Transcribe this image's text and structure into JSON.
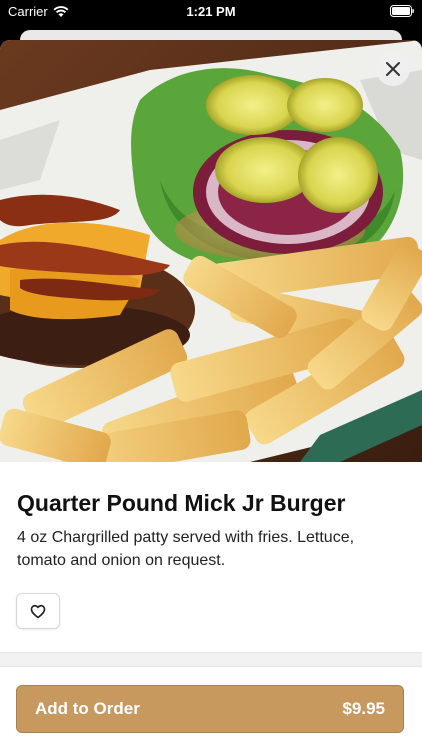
{
  "status_bar": {
    "carrier": "Carrier",
    "time": "1:21 PM",
    "wifi_icon": "wifi-icon",
    "battery_icon": "battery-icon"
  },
  "item": {
    "image_alt": "burger-with-bacon-cheese-and-fries",
    "title": "Quarter Pound Mick Jr Burger",
    "description": "4 oz Chargrilled patty served with fries.  Lettuce, tomato and onion on request."
  },
  "actions": {
    "close_icon": "close-icon",
    "favorite_icon": "heart-icon",
    "add_label": "Add to Order",
    "price": "$9.95"
  },
  "colors": {
    "accent": "#c7995f",
    "status_bar_bg": "#000000"
  }
}
